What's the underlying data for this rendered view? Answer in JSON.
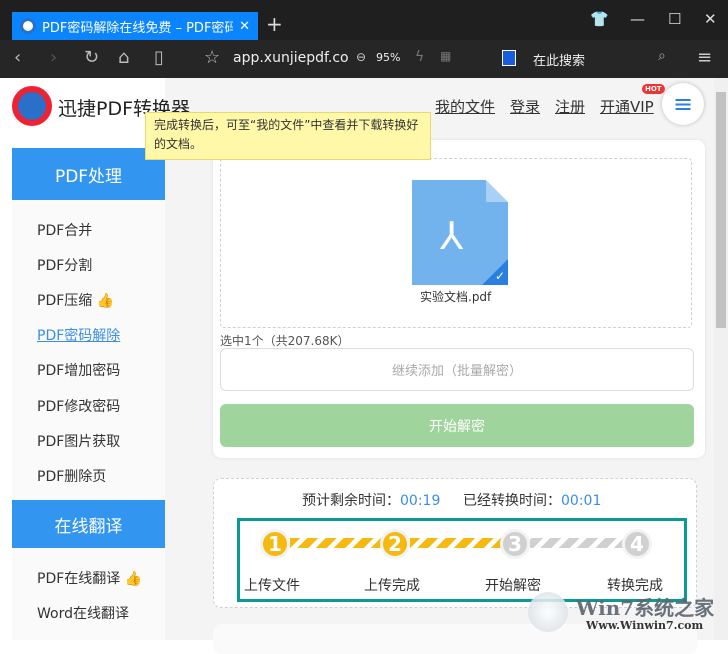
{
  "browser": {
    "tab_title": "PDF密码解除在线免费 – PDF密码移除",
    "url": "app.xunjiepdf.co",
    "zoom": "95%",
    "search_placeholder": "在此搜索"
  },
  "header": {
    "logo_text": "迅捷PDF转换器",
    "nav": [
      "我的文件",
      "登录",
      "注册",
      "开通VIP"
    ],
    "hot_badge": "HOT"
  },
  "tooltip": "完成转换后，可至“我的文件”中查看并下载转换好的文档。",
  "sidebar": {
    "section1": "PDF处理",
    "items1": [
      "PDF合并",
      "PDF分割",
      "PDF压缩",
      "PDF密码解除",
      "PDF增加密码",
      "PDF修改密码",
      "PDF图片获取",
      "PDF删除页"
    ],
    "active": "PDF密码解除",
    "section2": "在线翻译",
    "items2": [
      "PDF在线翻译",
      "Word在线翻译"
    ]
  },
  "upload": {
    "file_name": "实验文档.pdf",
    "selected": "选中1个（共207.68K）",
    "add_more": "继续添加（批量解密）",
    "start": "开始解密"
  },
  "progress": {
    "remaining_label": "预计剩余时间：",
    "remaining": "00:19",
    "elapsed_label": "已经转换时间：",
    "elapsed": "00:01",
    "steps": [
      "上传文件",
      "上传完成",
      "开始解密",
      "转换完成"
    ],
    "completed_steps": 2,
    "active_color": "#f5b90f",
    "inactive_color": "#d0d0d0"
  },
  "watermark": {
    "text": "Win7系统之家",
    "url": "Www.Winwin7.com"
  }
}
